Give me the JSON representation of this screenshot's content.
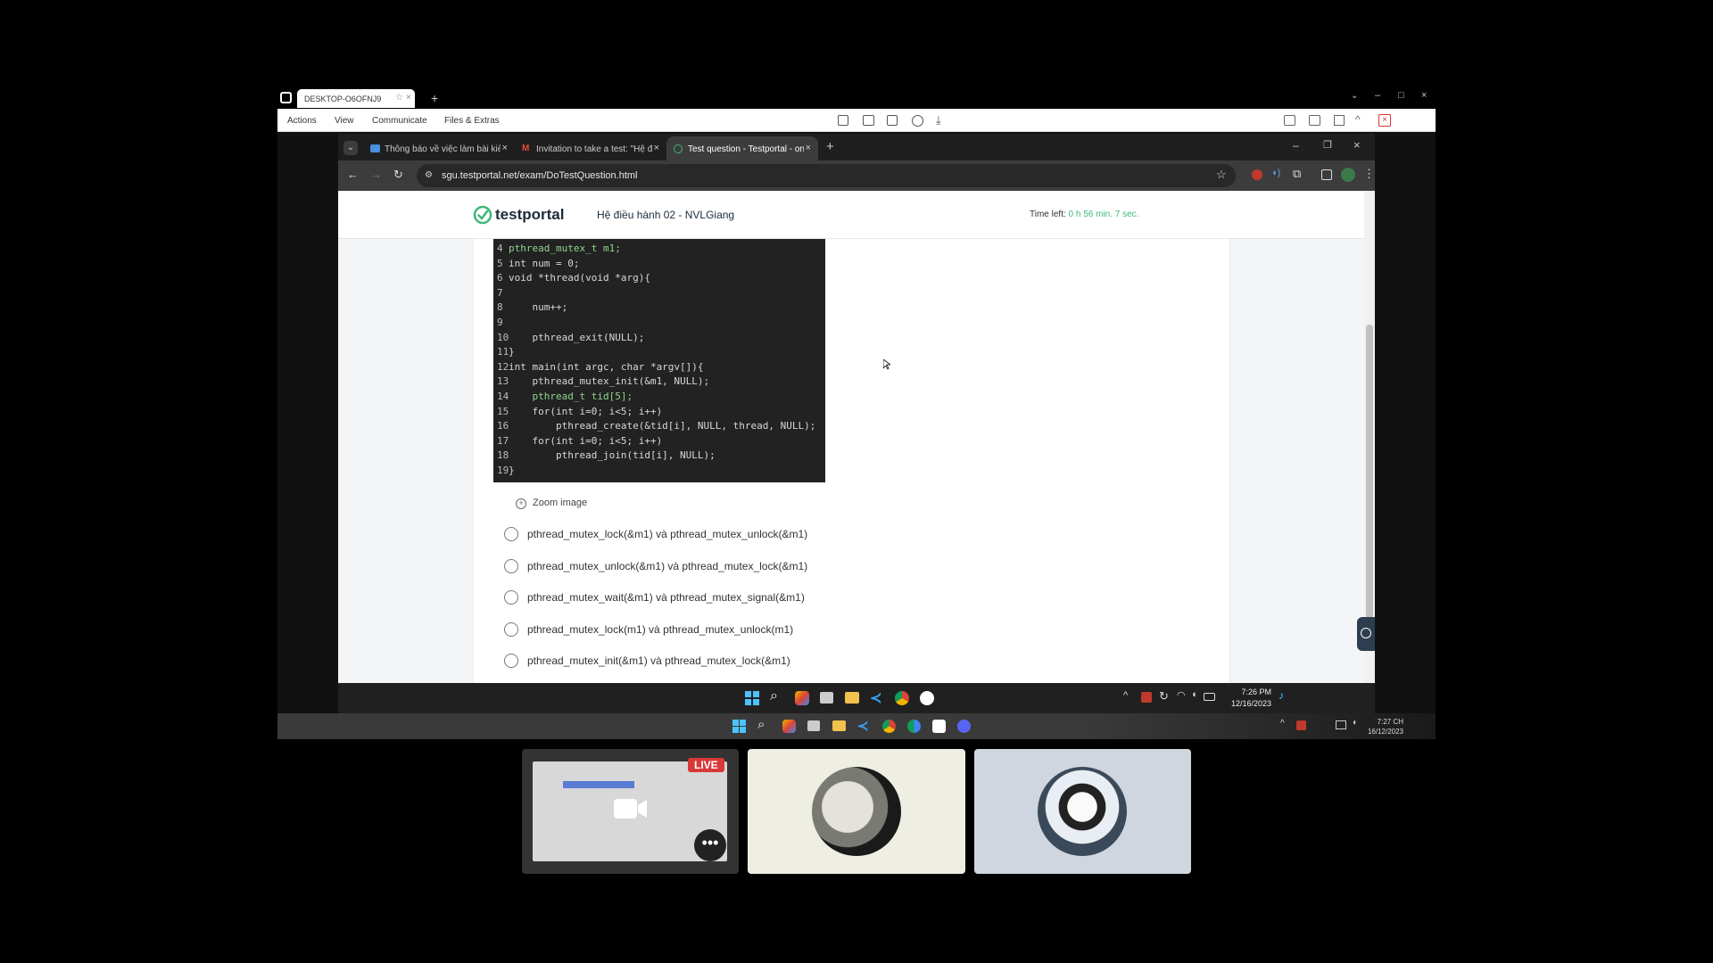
{
  "remote": {
    "tab_title": "DESKTOP-O6OFNJ9",
    "menu": {
      "actions": "Actions",
      "view": "View",
      "communicate": "Communicate",
      "files": "Files & Extras"
    }
  },
  "browser": {
    "tabs": [
      {
        "label": "Thông báo về việc làm bài kiểm",
        "active": false
      },
      {
        "label": "Invitation to take a test: \"Hệ điề",
        "active": false
      },
      {
        "label": "Test question - Testportal - onli",
        "active": true
      }
    ],
    "url": "sgu.testportal.net/exam/DoTestQuestion.html"
  },
  "page": {
    "brand": "testportal",
    "test_title": "Hệ điều hành 02 - NVLGiang",
    "time_left_label": "Time left:",
    "time_left_value": "0 h 56 min. 7 sec.",
    "zoom_label": "Zoom image",
    "code_lines": [
      {
        "n": "4",
        "t": "pthread_mutex_t m1;"
      },
      {
        "n": "5",
        "t": "int num = 0;"
      },
      {
        "n": "6",
        "t": "void *thread(void *arg){"
      },
      {
        "n": "7",
        "t": ""
      },
      {
        "n": "8",
        "t": "    num++;"
      },
      {
        "n": "9",
        "t": ""
      },
      {
        "n": "10",
        "t": "    pthread_exit(NULL);"
      },
      {
        "n": "11",
        "t": "}"
      },
      {
        "n": "12",
        "t": "int main(int argc, char *argv[]){"
      },
      {
        "n": "13",
        "t": "    pthread_mutex_init(&m1, NULL);"
      },
      {
        "n": "14",
        "t": "    pthread_t tid[5];"
      },
      {
        "n": "15",
        "t": "    for(int i=0; i<5; i++)"
      },
      {
        "n": "16",
        "t": "        pthread_create(&tid[i], NULL, thread, NULL);"
      },
      {
        "n": "17",
        "t": "    for(int i=0; i<5; i++)"
      },
      {
        "n": "18",
        "t": "        pthread_join(tid[i], NULL);"
      },
      {
        "n": "19",
        "t": "}"
      }
    ],
    "options": [
      "pthread_mutex_lock(&m1) và pthread_mutex_unlock(&m1)",
      "pthread_mutex_unlock(&m1) và pthread_mutex_lock(&m1)",
      "pthread_mutex_wait(&m1) và pthread_mutex_signal(&m1)",
      "pthread_mutex_lock(m1) và pthread_mutex_unlock(m1)",
      "pthread_mutex_init(&m1) và pthread_mutex_lock(&m1)"
    ]
  },
  "inner_taskbar": {
    "time": "7:26 PM",
    "date": "12/16/2023"
  },
  "outer_taskbar": {
    "time": "7:27 CH",
    "date": "16/12/2023"
  },
  "live_badge": "LIVE",
  "colors": {
    "brand_green": "#3cb878",
    "page_bg": "#f4f5f7",
    "code_bg": "#222222"
  }
}
